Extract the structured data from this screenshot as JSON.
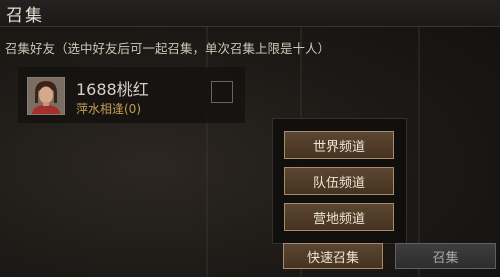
{
  "header": {
    "title": "召集"
  },
  "subtitle": "召集好友（选中好友后可一起召集，单次召集上限是十人）",
  "friend": {
    "name": "1688桃红",
    "status": "萍水相逢(0)",
    "avatar_icon": "portrait-avatar",
    "selected": false
  },
  "channels": [
    {
      "label": "世界频道"
    },
    {
      "label": "队伍频道"
    },
    {
      "label": "营地频道"
    }
  ],
  "footer": {
    "quick_summon_label": "快速召集",
    "summon_label": "召集"
  },
  "colors": {
    "accent_button": "#4e3b28",
    "button_border": "#a48b6a",
    "status_text": "#c69c55",
    "disabled_button": "#34363a"
  }
}
